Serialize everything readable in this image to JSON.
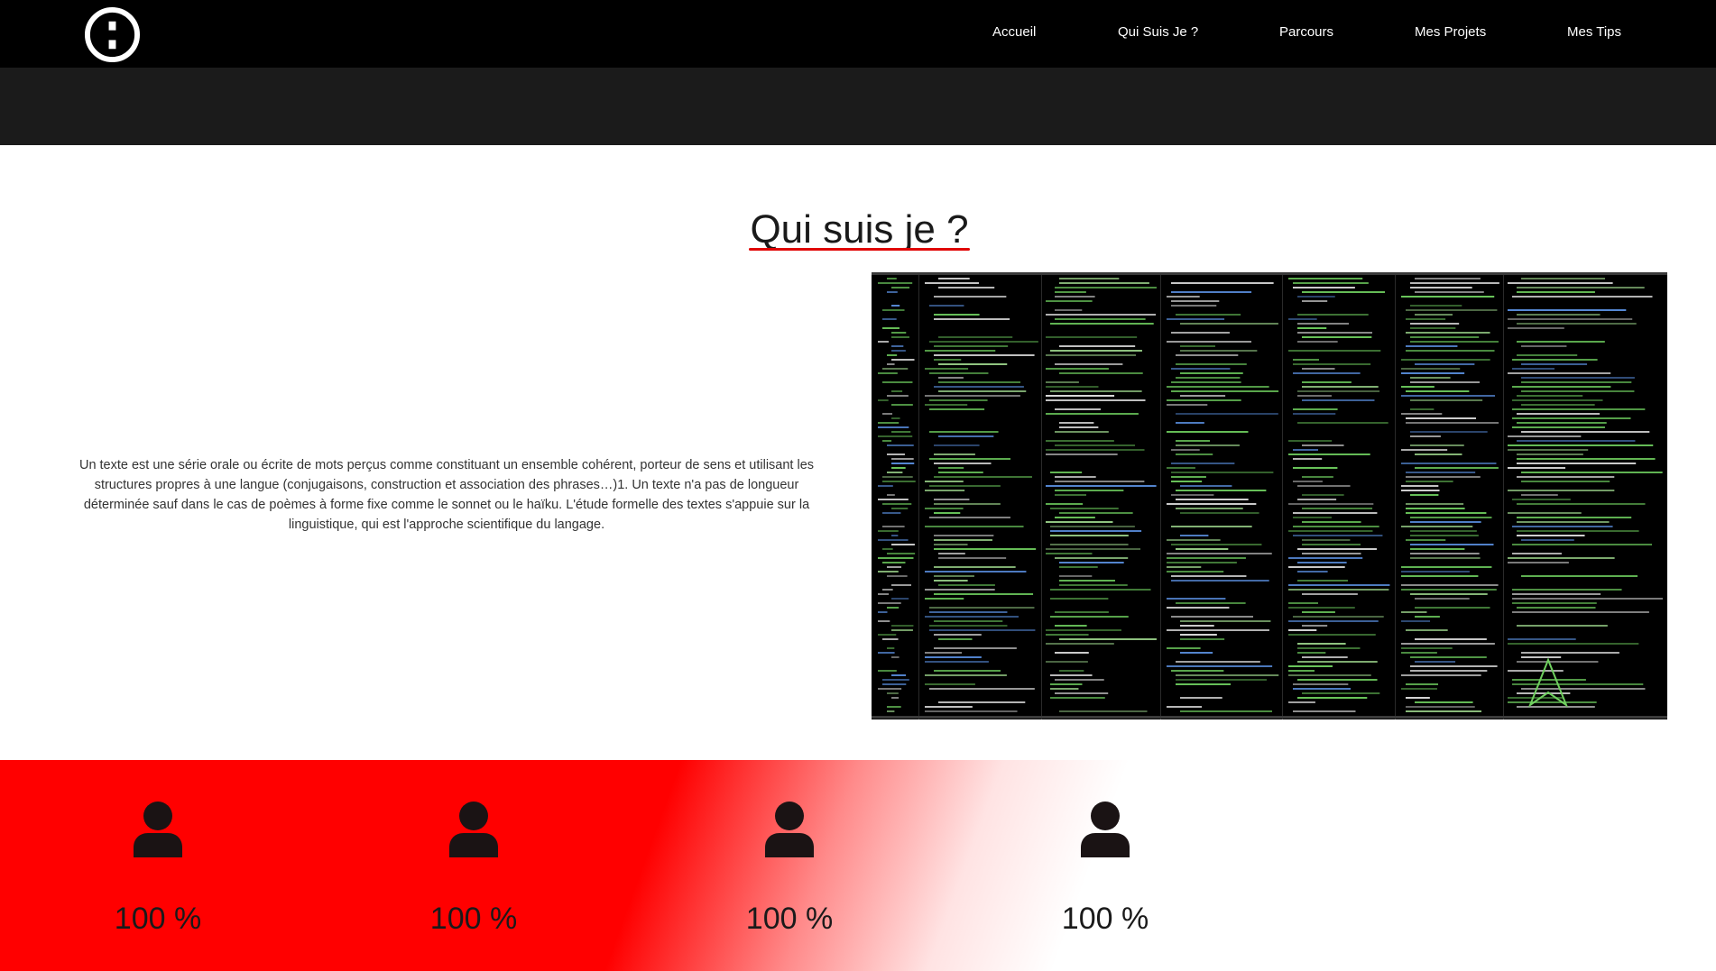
{
  "nav": {
    "items": [
      {
        "label": "Accueil"
      },
      {
        "label": "Qui Suis Je ?"
      },
      {
        "label": "Parcours"
      },
      {
        "label": "Mes Projets"
      },
      {
        "label": "Mes Tips"
      }
    ]
  },
  "about": {
    "title": "Qui suis je ?",
    "paragraph": "Un texte est une série orale ou écrite de mots perçus comme constituant un ensemble cohérent, porteur de sens et utilisant les structures propres à une langue (conjugaisons, construction et association des phrases…)1. Un texte n'a pas de longueur déterminée sauf dans le cas de poèmes à forme fixe comme le sonnet ou le haïku. L'étude formelle des textes s'appuie sur la linguistique, qui est l'approche scientifique du langage."
  },
  "stats": [
    {
      "icon": "user-icon",
      "value": "100 %"
    },
    {
      "icon": "user-icon",
      "value": "100 %"
    },
    {
      "icon": "user-icon",
      "value": "100 %"
    },
    {
      "icon": "user-icon",
      "value": "100 %"
    }
  ],
  "colors": {
    "navbar": "#000000",
    "band": "#1b1b1b",
    "accent": "#ff0000",
    "underline": "#e00000",
    "code_green": "#6fcf5f",
    "code_blue": "#5a8fe0"
  }
}
